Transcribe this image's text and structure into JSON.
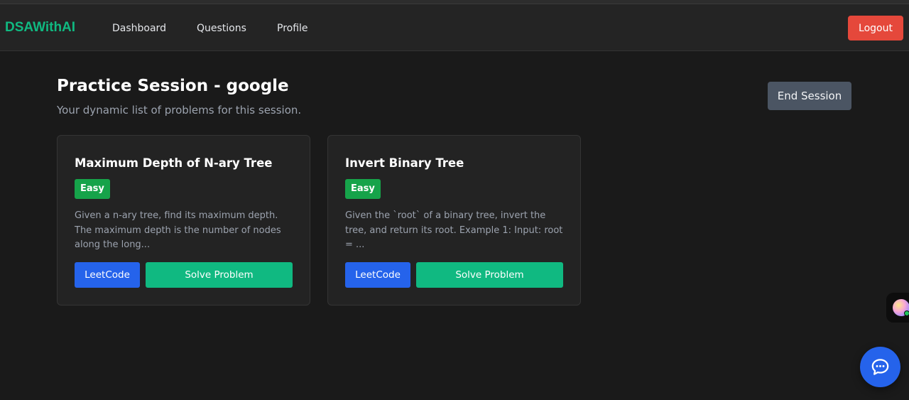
{
  "nav": {
    "brand": "DSAWithAI",
    "links": [
      "Dashboard",
      "Questions",
      "Profile"
    ],
    "logout_label": "Logout"
  },
  "header": {
    "title": "Practice Session - google",
    "subtitle": "Your dynamic list of problems for this session.",
    "end_session_label": "End Session"
  },
  "problems": [
    {
      "title": "Maximum Depth of N-ary Tree",
      "difficulty": "Easy",
      "description": "Given a n-ary tree, find its maximum depth. The maximum depth is the number of nodes along the long...",
      "leetcode_label": "LeetCode",
      "solve_label": "Solve Problem"
    },
    {
      "title": "Invert Binary Tree",
      "difficulty": "Easy",
      "description": "Given the `root` of a binary tree, invert the tree, and return its root. Example 1: Input: root = ...",
      "leetcode_label": "LeetCode",
      "solve_label": "Solve Problem"
    }
  ],
  "colors": {
    "brand": "#10b981",
    "logout": "#e5483b",
    "easy_badge": "#16a34a",
    "leetcode_button": "#2563eb",
    "solve_button": "#10b981",
    "end_session_button": "#4b5563"
  },
  "icons": {
    "chat": "chat-bubble-icon",
    "assistant": "assistant-avatar-icon"
  }
}
